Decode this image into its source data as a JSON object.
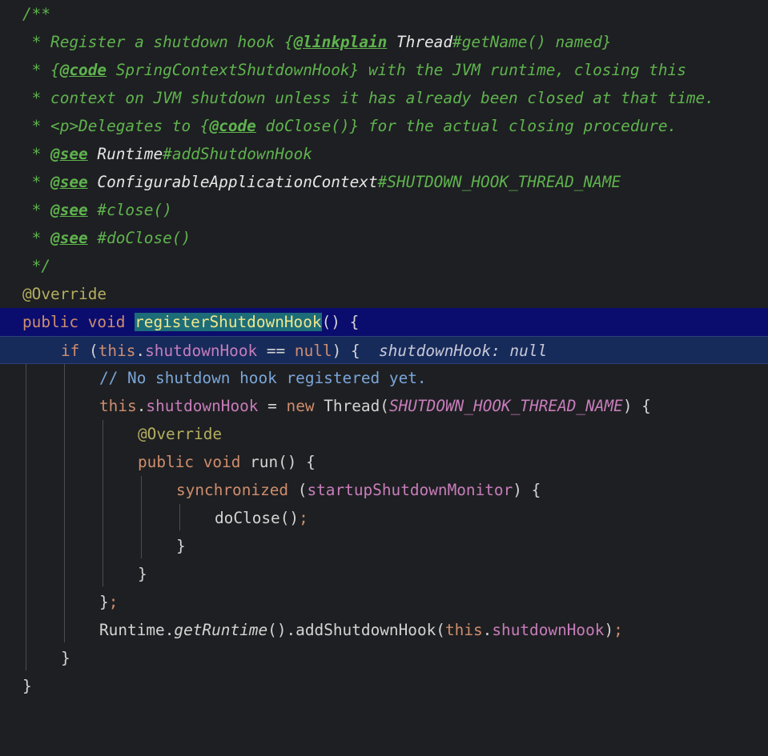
{
  "editor": {
    "lines": {
      "l1": {
        "doc": "/**"
      },
      "l2": {
        "a": " * Register a shutdown hook {",
        "tag": "@linkplain",
        "ref": " Thread",
        "b": "#getName() named}"
      },
      "l3": {
        "a": " * {",
        "tag": "@code",
        "b": " SpringContextShutdownHook} with the JVM runtime, closing this"
      },
      "l4": {
        "a": " * context on JVM shutdown unless it has already been closed at that time."
      },
      "l5": {
        "a": " * <p>Delegates to {",
        "tag": "@code",
        "b": " doClose()} for the actual closing procedure."
      },
      "l6": {
        "a": " * ",
        "tag": "@see",
        "ref": " Runtime",
        "b": "#addShutdownHook"
      },
      "l7": {
        "a": " * ",
        "tag": "@see",
        "ref": " ConfigurableApplicationContext",
        "b": "#SHUTDOWN_HOOK_THREAD_NAME"
      },
      "l8": {
        "a": " * ",
        "tag": "@see",
        "b": " #close()"
      },
      "l9": {
        "a": " * ",
        "tag": "@see",
        "b": " #doClose()"
      },
      "l10": {
        "a": " */"
      },
      "l11": {
        "ann": "@Override"
      },
      "l12": {
        "kw": "public void ",
        "sel": "registerShutdownHook",
        "rest": "() {"
      },
      "l13": {
        "kw1": "if",
        "p1": " (",
        "kw2": "this",
        "p2": ".",
        "fld": "shutdownHook",
        "p3": " == ",
        "kw3": "null",
        "p4": ") {  ",
        "hint": "shutdownHook: null"
      },
      "l14": {
        "com": "// No shutdown hook registered yet."
      },
      "l15": {
        "kw1": "this",
        "p1": ".",
        "fld": "shutdownHook",
        "p2": " = ",
        "kw2": "new",
        "p3": " Thread(",
        "const": "SHUTDOWN_HOOK_THREAD_NAME",
        "p4": ") {"
      },
      "l16": {
        "ann": "@Override"
      },
      "l17": {
        "kw": "public void ",
        "p": "run() {"
      },
      "l18": {
        "kw": "synchronized",
        "p1": " (",
        "fld": "startupShutdownMonitor",
        "p2": ") {"
      },
      "l19": {
        "p": "doClose()",
        "semi": ";"
      },
      "l20": {
        "p": "}"
      },
      "l21": {
        "p": "}"
      },
      "l22": {
        "p": "}",
        "semi": ";"
      },
      "l23": {
        "p1": "Runtime.",
        "meth": "getRuntime",
        "p2": "().addShutdownHook(",
        "kw": "this",
        "p3": ".",
        "fld": "shutdownHook",
        "p4": ")",
        "semi": ";"
      },
      "l24": {
        "p": "}"
      },
      "l25": {
        "p": "}"
      }
    }
  }
}
